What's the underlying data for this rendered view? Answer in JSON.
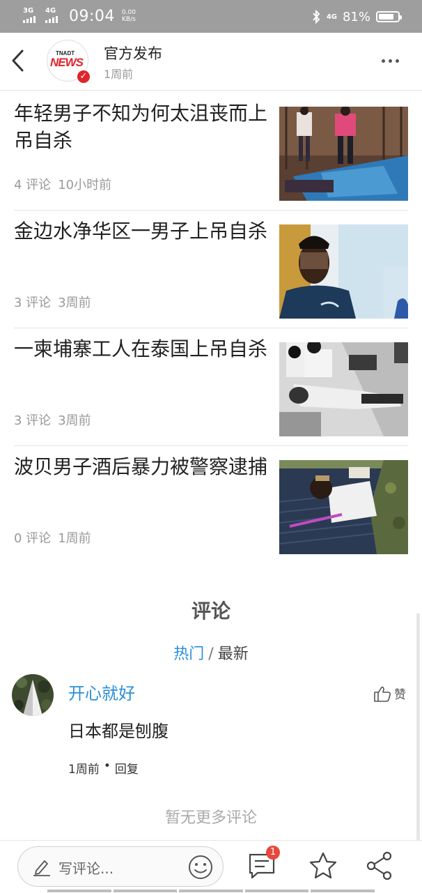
{
  "status_bar": {
    "net1": "3G",
    "net2": "4G",
    "time": "09:04",
    "speed_value": "0.00",
    "speed_unit": "KB/s",
    "net_right": "4G",
    "battery_percent": "81%",
    "battery_level": 0.81
  },
  "header": {
    "logo_text_top": "TNADT",
    "logo_text_main": "NEWS",
    "publisher": "官方发布",
    "publish_time": "1周前"
  },
  "articles": [
    {
      "title": "年轻男子不知为何太沮丧而上吊自杀",
      "comments": "4 评论",
      "time": "10小时前"
    },
    {
      "title": "金边水净华区一男子上吊自杀",
      "comments": "3 评论",
      "time": "3周前"
    },
    {
      "title": "一柬埔寨工人在泰国上吊自杀",
      "comments": "3 评论",
      "time": "3周前"
    },
    {
      "title": "波贝男子酒后暴力被警察逮捕",
      "comments": "0 评论",
      "time": "1周前"
    }
  ],
  "comments": {
    "heading": "评论",
    "tab_hot": "热门",
    "tab_sep": "/",
    "tab_new": "最新",
    "items": [
      {
        "user": "开心就好",
        "like_label": "赞",
        "text": "日本都是刨腹",
        "time": "1周前",
        "dot": "•",
        "reply": "回复"
      }
    ],
    "no_more": "暂无更多评论"
  },
  "bottom_bar": {
    "input_placeholder": "写评论...",
    "comment_badge": "1"
  },
  "colors": {
    "accent_blue": "#2a8fd8",
    "brand_red": "#e0242b",
    "status_bar": "#9e9e9e"
  }
}
